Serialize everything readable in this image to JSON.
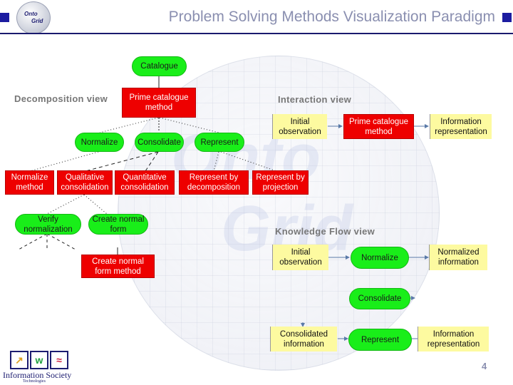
{
  "header": {
    "title": "Problem Solving Methods Visualization Paradigm",
    "logo_text_top": "Onto",
    "logo_text_bottom": "Grid"
  },
  "background": {
    "watermark_top": "Onto",
    "watermark_bottom": "Grid"
  },
  "decomposition_view": {
    "label": "Decomposition view",
    "nodes": {
      "catalogue": "Catalogue",
      "prime_method": "Prime catalogue method",
      "normalize": "Normalize",
      "consolidate": "Consolidate",
      "represent": "Represent",
      "normalize_method": "Normalize method",
      "qualitative": "Qualitative consolidation",
      "quantitative": "Quantitative consolidation",
      "repr_decomp": "Represent by decomposition",
      "repr_proj": "Represent by projection",
      "verify": "Verify normalization",
      "create_form": "Create normal form",
      "create_form_method": "Create normal form method"
    }
  },
  "interaction_view": {
    "label": "Interaction view",
    "nodes": {
      "initial": "Initial observation",
      "prime_method": "Prime catalogue method",
      "info_repr": "Information representation"
    }
  },
  "knowledge_flow_view": {
    "label": "Knowledge Flow view",
    "nodes": {
      "initial": "Initial observation",
      "normalize": "Normalize",
      "normalized_info": "Normalized information",
      "consolidate": "Consolidate",
      "consolidated_info": "Consolidated information",
      "represent": "Represent",
      "info_repr": "Information representation"
    }
  },
  "footer": {
    "page_number": "4",
    "ist_label": "Information Society",
    "ist_sub": "Technologies",
    "ist_icons": [
      "↗",
      "w",
      "≈"
    ]
  },
  "colors": {
    "process_green": "#19ee19",
    "method_red": "#ee0000",
    "data_yellow": "#fdfaa0",
    "title_blue": "#8a8fb0",
    "rule_navy": "#1a1a6e"
  }
}
